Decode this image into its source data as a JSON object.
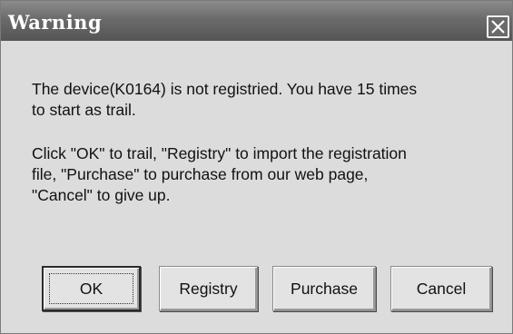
{
  "dialog": {
    "title": "Warning",
    "close_icon": "close-x-icon",
    "message_line1": "The device(K0164) is not registried. You have 15 times\nto start as trail.",
    "message_line2": "Click \"OK\" to trail, \"Registry\" to import the registration\nfile, \"Purchase\" to purchase from our web page,\n\"Cancel\" to give up."
  },
  "buttons": {
    "ok": "OK",
    "registry": "Registry",
    "purchase": "Purchase",
    "cancel": "Cancel"
  },
  "colors": {
    "titlebar": "#6b6b6b",
    "dialog_bg": "#dcdcdc",
    "title_text": "#ffffff"
  }
}
